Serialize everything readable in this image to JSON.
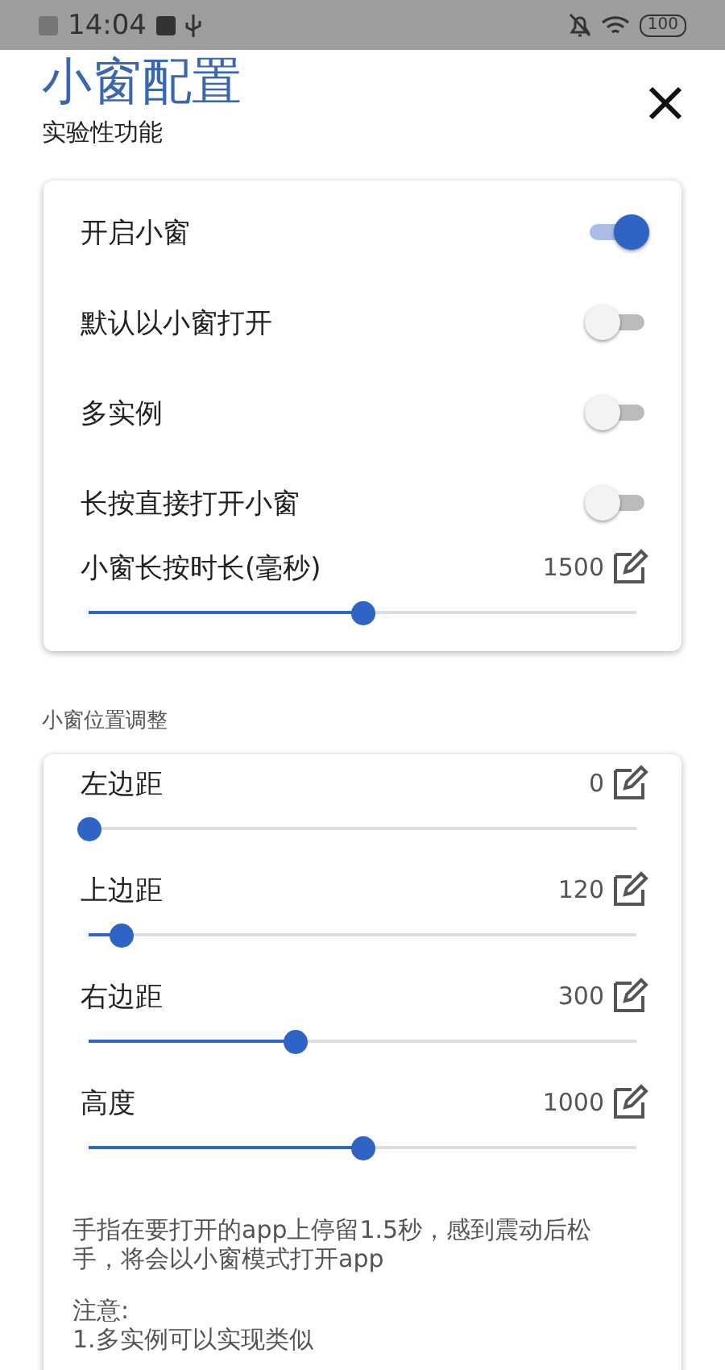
{
  "status_bar": {
    "time": "14:04",
    "battery": "100"
  },
  "header": {
    "title": "小窗配置",
    "subtitle": "实验性功能"
  },
  "main_settings": [
    {
      "kind": "toggle",
      "label": "开启小窗",
      "on": true
    },
    {
      "kind": "toggle",
      "label": "默认以小窗打开",
      "on": false
    },
    {
      "kind": "toggle",
      "label": "多实例",
      "on": false
    },
    {
      "kind": "toggle",
      "label": "长按直接打开小窗",
      "on": false
    },
    {
      "kind": "slider",
      "label": "小窗长按时长(毫秒)",
      "value": "1500",
      "level": 0.5
    }
  ],
  "position_section": {
    "title": "小窗位置调整",
    "sliders": [
      {
        "label": "左边距",
        "value": "0",
        "level": 0
      },
      {
        "label": "上边距",
        "value": "120",
        "level": 0.06
      },
      {
        "label": "右边距",
        "value": "300",
        "level": 0.375
      },
      {
        "label": "高度",
        "value": "1000",
        "level": 0.5
      }
    ],
    "notes": [
      "手指在要打开的app上停留1.5秒，感到震动后松手，将会以小窗模式打开app",
      "注意:",
      "1.多实例可以实现类似"
    ]
  }
}
